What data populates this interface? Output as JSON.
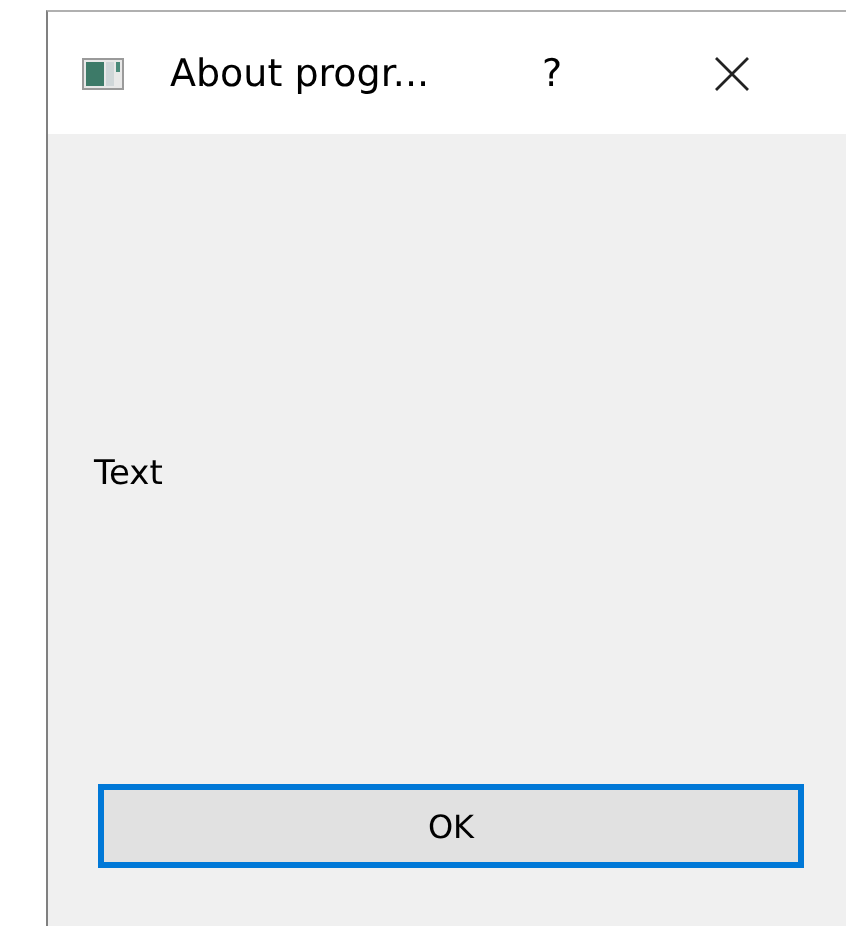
{
  "window": {
    "title": "About progr...",
    "help": "?"
  },
  "body": {
    "text": "Text"
  },
  "buttons": [
    {
      "label": "OK",
      "focused": true
    }
  ]
}
